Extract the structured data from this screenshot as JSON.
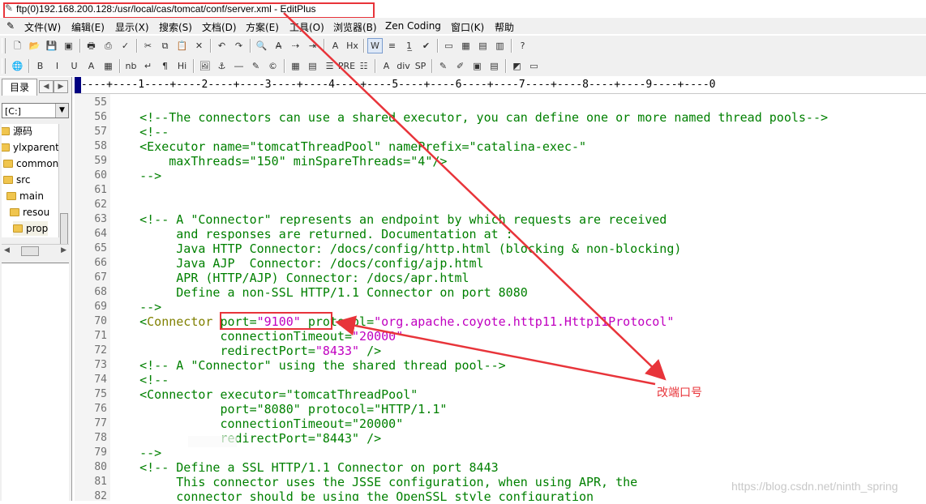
{
  "window": {
    "title": "ftp(0)192.168.200.128:/usr/local/cas/tomcat/conf/server.xml - EditPlus"
  },
  "menu": [
    "文件(W)",
    "编辑(E)",
    "显示(X)",
    "搜索(S)",
    "文档(D)",
    "方案(E)",
    "工具(O)",
    "浏览器(B)",
    "Zen Coding",
    "窗口(K)",
    "帮助"
  ],
  "toolbar1": [
    {
      "name": "new-icon",
      "glyph": "🗋"
    },
    {
      "name": "open-icon",
      "glyph": "📂"
    },
    {
      "name": "save-icon",
      "glyph": "💾"
    },
    {
      "name": "save-all-icon",
      "glyph": "▣"
    },
    {
      "name": "print-icon",
      "glyph": "🖶"
    },
    {
      "name": "print-preview-icon",
      "glyph": "⎙"
    },
    {
      "name": "spell-check-icon",
      "glyph": "✓"
    },
    {
      "name": "cut-icon",
      "glyph": "✂"
    },
    {
      "name": "copy-icon",
      "glyph": "⧉"
    },
    {
      "name": "paste-icon",
      "glyph": "📋"
    },
    {
      "name": "delete-icon",
      "glyph": "✕"
    },
    {
      "name": "undo-icon",
      "glyph": "↶"
    },
    {
      "name": "redo-icon",
      "glyph": "↷"
    },
    {
      "name": "find-icon",
      "glyph": "🔍"
    },
    {
      "name": "replace-icon",
      "glyph": "A̶"
    },
    {
      "name": "go-to-icon",
      "glyph": "⇢"
    },
    {
      "name": "indent-icon",
      "glyph": "⇥"
    },
    {
      "name": "font-icon",
      "glyph": "A"
    },
    {
      "name": "heading-icon",
      "glyph": "Hx"
    },
    {
      "name": "word-wrap-icon",
      "glyph": "W"
    },
    {
      "name": "wrap-lines-icon",
      "glyph": "≡"
    },
    {
      "name": "ruler-icon",
      "glyph": "1̲"
    },
    {
      "name": "check-icon",
      "glyph": "✔"
    },
    {
      "name": "screen-icon",
      "glyph": "▭"
    },
    {
      "name": "layout-icon",
      "glyph": "▦"
    },
    {
      "name": "window-icon",
      "glyph": "▤"
    },
    {
      "name": "tile-icon",
      "glyph": "▥"
    },
    {
      "name": "help-icon",
      "glyph": "?"
    }
  ],
  "toolbar2": [
    {
      "name": "browser-icon",
      "glyph": "🌐"
    },
    {
      "name": "bold-icon",
      "glyph": "B"
    },
    {
      "name": "italic-icon",
      "glyph": "I"
    },
    {
      "name": "underline-icon",
      "glyph": "U"
    },
    {
      "name": "font-color-icon",
      "glyph": "A"
    },
    {
      "name": "color-grid-icon",
      "glyph": "▦"
    },
    {
      "name": "nbsp-icon",
      "glyph": "nb"
    },
    {
      "name": "line-break-icon",
      "glyph": "↵"
    },
    {
      "name": "paragraph-icon",
      "glyph": "¶"
    },
    {
      "name": "heading-tag-icon",
      "glyph": "Hi"
    },
    {
      "name": "image-icon",
      "glyph": "🖼"
    },
    {
      "name": "anchor-icon",
      "glyph": "⚓"
    },
    {
      "name": "hr-icon",
      "glyph": "―"
    },
    {
      "name": "pen-icon",
      "glyph": "✎"
    },
    {
      "name": "special-char-icon",
      "glyph": "©"
    },
    {
      "name": "table-icon",
      "glyph": "▦"
    },
    {
      "name": "form-icon",
      "glyph": "▤"
    },
    {
      "name": "center-icon",
      "glyph": "☰"
    },
    {
      "name": "pre-icon",
      "glyph": "PRE"
    },
    {
      "name": "list-icon",
      "glyph": "☷"
    },
    {
      "name": "text-icon",
      "glyph": "A"
    },
    {
      "name": "div-icon",
      "glyph": "div"
    },
    {
      "name": "span-icon",
      "glyph": "SP"
    },
    {
      "name": "edit-icon",
      "glyph": "✎"
    },
    {
      "name": "style-icon",
      "glyph": "✐"
    },
    {
      "name": "preview-icon",
      "glyph": "▣"
    },
    {
      "name": "template-icon",
      "glyph": "▤"
    },
    {
      "name": "color-picker-icon",
      "glyph": "◩"
    },
    {
      "name": "panel-icon",
      "glyph": "▭"
    }
  ],
  "sidebar": {
    "tab_label": "目录",
    "drive": "[C:]",
    "tree": [
      {
        "label": "源码",
        "indent": 0
      },
      {
        "label": "ylxparent",
        "indent": 0
      },
      {
        "label": "common",
        "indent": 1
      },
      {
        "label": "src",
        "indent": 1
      },
      {
        "label": "main",
        "indent": 2
      },
      {
        "label": "resou",
        "indent": 3
      },
      {
        "label": "prop",
        "indent": 4,
        "selected": true
      }
    ]
  },
  "ruler": "----+----1----+----2----+----3----+----4----+----5----+----6----+----7----+----8----+----9----+----0",
  "editor": {
    "lines": [
      {
        "n": "55",
        "tokens": []
      },
      {
        "n": "56",
        "tokens": [
          [
            "c",
            "    <!--The connectors can use a shared executor, you can define one or more named thread pools-->"
          ]
        ]
      },
      {
        "n": "57",
        "tokens": [
          [
            "c",
            "    <!--"
          ]
        ]
      },
      {
        "n": "58",
        "tokens": [
          [
            "c",
            "    <Executor name=\"tomcatThreadPool\" namePrefix=\"catalina-exec-\""
          ]
        ]
      },
      {
        "n": "59",
        "tokens": [
          [
            "c",
            "        maxThreads=\"150\" minSpareThreads=\"4\"/>"
          ]
        ]
      },
      {
        "n": "60",
        "tokens": [
          [
            "c",
            "    -->"
          ]
        ]
      },
      {
        "n": "61",
        "tokens": []
      },
      {
        "n": "62",
        "tokens": []
      },
      {
        "n": "63",
        "tokens": [
          [
            "c",
            "    <!-- A \"Connector\" represents an endpoint by which requests are received"
          ]
        ]
      },
      {
        "n": "64",
        "tokens": [
          [
            "c",
            "         and responses are returned. Documentation at :"
          ]
        ]
      },
      {
        "n": "65",
        "tokens": [
          [
            "c",
            "         Java HTTP Connector: /docs/config/http.html (blocking & non-blocking)"
          ]
        ]
      },
      {
        "n": "66",
        "tokens": [
          [
            "c",
            "         Java AJP  Connector: /docs/config/ajp.html"
          ]
        ]
      },
      {
        "n": "67",
        "tokens": [
          [
            "c",
            "         APR (HTTP/AJP) Connector: /docs/apr.html"
          ]
        ]
      },
      {
        "n": "68",
        "tokens": [
          [
            "c",
            "         Define a non-SSL HTTP/1.1 Connector on port 8080"
          ]
        ]
      },
      {
        "n": "69",
        "tokens": [
          [
            "c",
            "    -->"
          ]
        ]
      },
      {
        "n": "70",
        "tokens": [
          [
            "d",
            "    <"
          ],
          [
            "t",
            "Connector"
          ],
          [
            "p",
            " port="
          ],
          [
            "v",
            "\"9100\""
          ],
          [
            "p",
            " protocol="
          ],
          [
            "v",
            "\"org.apache.coyote.http11.Http11Protocol\""
          ]
        ]
      },
      {
        "n": "71",
        "tokens": [
          [
            "p",
            "               connectionTimeout="
          ],
          [
            "v",
            "\"20000\""
          ]
        ]
      },
      {
        "n": "72",
        "tokens": [
          [
            "p",
            "               redirectPort="
          ],
          [
            "v",
            "\"8433\""
          ],
          [
            "p",
            " />"
          ]
        ]
      },
      {
        "n": "73",
        "tokens": [
          [
            "c",
            "    <!-- A \"Connector\" using the shared thread pool-->"
          ]
        ]
      },
      {
        "n": "74",
        "tokens": [
          [
            "c",
            "    <!--"
          ]
        ]
      },
      {
        "n": "75",
        "tokens": [
          [
            "c",
            "    <Connector executor=\"tomcatThreadPool\""
          ]
        ]
      },
      {
        "n": "76",
        "tokens": [
          [
            "c",
            "               port=\"8080\" protocol=\"HTTP/1.1\""
          ]
        ]
      },
      {
        "n": "77",
        "tokens": [
          [
            "c",
            "               connectionTimeout=\"20000\""
          ]
        ]
      },
      {
        "n": "78",
        "tokens": [
          [
            "c",
            "               redirectPort=\"8443\" />"
          ]
        ]
      },
      {
        "n": "79",
        "tokens": [
          [
            "c",
            "    -->"
          ]
        ]
      },
      {
        "n": "80",
        "tokens": [
          [
            "c",
            "    <!-- Define a SSL HTTP/1.1 Connector on port 8443"
          ]
        ]
      },
      {
        "n": "81",
        "tokens": [
          [
            "c",
            "         This connector uses the JSSE configuration, when using APR, the"
          ]
        ]
      },
      {
        "n": "82",
        "tokens": [
          [
            "c",
            "         connector should be using the OpenSSL style configuration"
          ]
        ]
      }
    ]
  },
  "annotation": "改端口号",
  "watermark": "https://blog.csdn.net/ninth_spring",
  "colors": {
    "highlight": "#e8343a",
    "comment": "#008000",
    "attr_value": "#c000c0",
    "tag": "#808000"
  }
}
